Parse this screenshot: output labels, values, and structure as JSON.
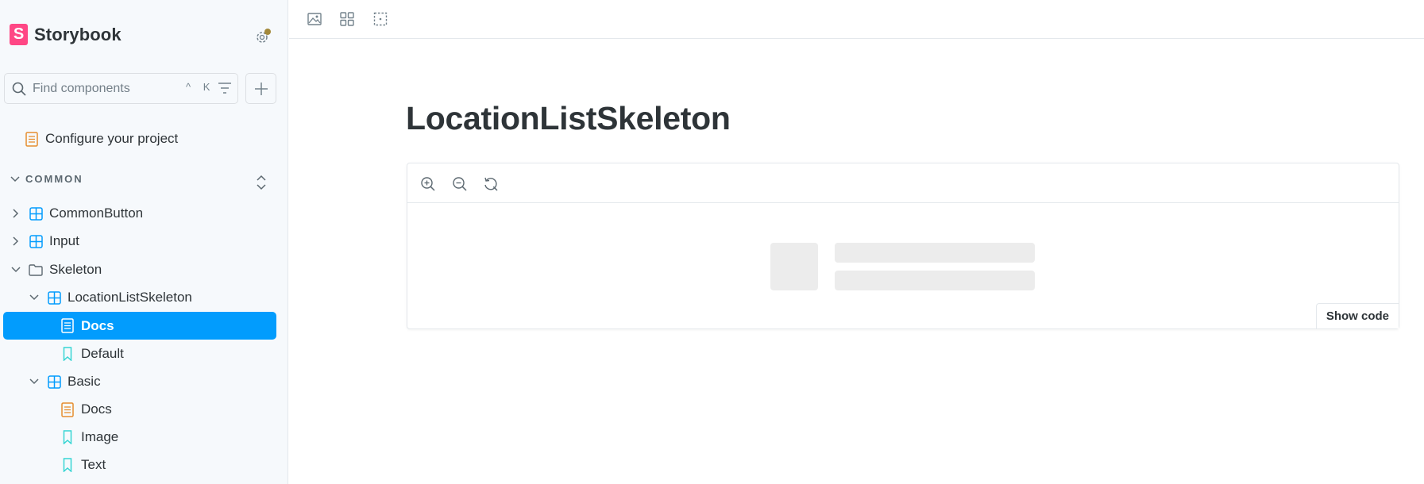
{
  "brand": {
    "name": "Storybook",
    "logo_letter": "S"
  },
  "search": {
    "placeholder": "Find components",
    "shortcut": "^ K"
  },
  "sidebar": {
    "top_items": [
      {
        "label": "Configure your project",
        "icon": "document-icon"
      }
    ],
    "section": {
      "label": "COMMON"
    },
    "tree": [
      {
        "label": "CommonButton",
        "icon": "component-icon",
        "expand": "collapsed"
      },
      {
        "label": "Input",
        "icon": "component-icon",
        "expand": "collapsed"
      },
      {
        "label": "Skeleton",
        "icon": "folder-icon",
        "expand": "expanded"
      },
      {
        "label": "LocationListSkeleton",
        "icon": "component-icon",
        "expand": "expanded"
      },
      {
        "label": "Docs",
        "icon": "document-icon",
        "selected": true
      },
      {
        "label": "Default",
        "icon": "bookmark-icon"
      },
      {
        "label": "Basic",
        "icon": "component-icon",
        "expand": "expanded"
      },
      {
        "label": "Docs",
        "icon": "document-icon"
      },
      {
        "label": "Image",
        "icon": "bookmark-icon"
      },
      {
        "label": "Text",
        "icon": "bookmark-icon"
      }
    ]
  },
  "main": {
    "title": "LocationListSkeleton",
    "show_code_label": "Show code"
  },
  "colors": {
    "accent": "#029cfd",
    "brand": "#ff4785",
    "doc_icon": "#e68e2e",
    "component_icon": "#029cfd",
    "skeleton": "#ececec"
  }
}
